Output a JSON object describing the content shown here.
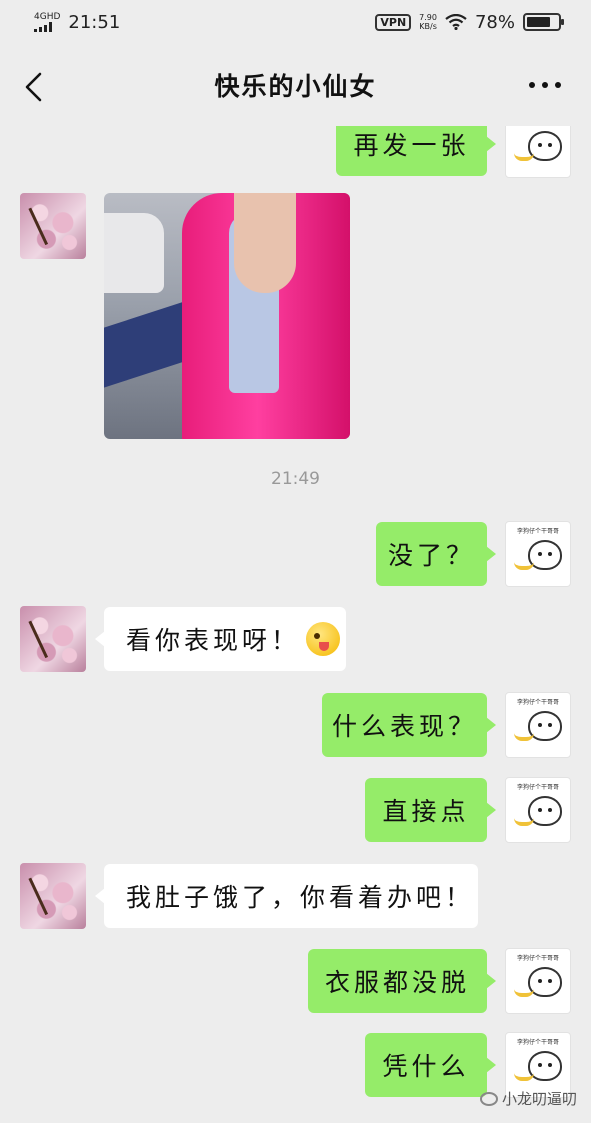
{
  "status_bar": {
    "network": "4GHD",
    "time": "21:51",
    "vpn": "VPN",
    "speed_value": "7.90",
    "speed_unit": "KB/s",
    "battery": "78%",
    "battery_level": 0.78
  },
  "header": {
    "title": "快乐的小仙女",
    "back_icon": "chevron-left-icon",
    "more_icon": "more-dots-icon"
  },
  "sticker_caption": "李狗仔个干哥哥",
  "messages": [
    {
      "side": "right",
      "text": "再发一张"
    },
    {
      "side": "left",
      "type": "image"
    },
    {
      "type": "time",
      "text": "21:49"
    },
    {
      "side": "right",
      "text": "没了？"
    },
    {
      "side": "left",
      "text": "看你表现呀！",
      "emoji": "winking-tongue-emoji"
    },
    {
      "side": "right",
      "text": "什么表现？"
    },
    {
      "side": "right",
      "text": "直接点"
    },
    {
      "side": "left",
      "text": "我肚子饿了，你看着办吧！"
    },
    {
      "side": "right",
      "text": "衣服都没脱"
    },
    {
      "side": "right",
      "text": "凭什么"
    }
  ],
  "watermark": "小龙叨逼叨",
  "colors": {
    "background": "#ededed",
    "sent_bubble": "#95ec69",
    "received_bubble": "#ffffff"
  }
}
